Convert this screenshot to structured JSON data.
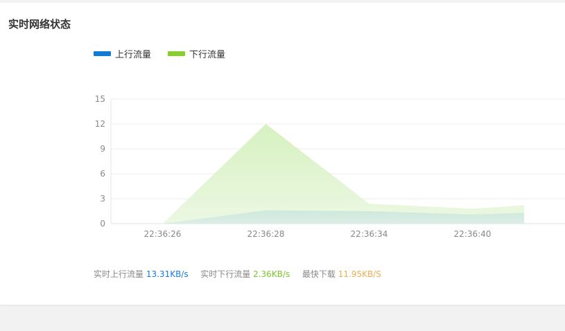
{
  "title": "实时网络状态",
  "colors": {
    "upload": "#0e7bd6",
    "download": "#86cf2e",
    "max": "#f0ad4e"
  },
  "chart_data": {
    "type": "area",
    "x": [
      "",
      "22:36:26",
      "",
      "22:36:28",
      "",
      "22:36:34",
      "",
      "22:36:40",
      ""
    ],
    "x_tick_labels": [
      "22:36:26",
      "22:36:28",
      "22:36:34",
      "22:36:40"
    ],
    "series": [
      {
        "name": "上行流量",
        "key": "upload",
        "values": [
          null,
          0,
          0.8,
          1.6,
          1.55,
          1.5,
          1.3,
          1.1,
          1.3
        ]
      },
      {
        "name": "下行流量",
        "key": "download",
        "values": [
          null,
          0,
          6,
          12,
          7.2,
          2.4,
          2.1,
          1.8,
          2.2
        ]
      }
    ],
    "ylim": [
      0,
      15
    ],
    "yticks": [
      0,
      3,
      6,
      9,
      12,
      15
    ],
    "grid": true,
    "legend": "top-left"
  },
  "footer": {
    "upload_label": "实时上行流量",
    "upload_value": "13.31KB/s",
    "download_label": "实时下行流量",
    "download_value": "2.36KB/s",
    "max_label": "最快下载",
    "max_value": "11.95KB/S"
  }
}
